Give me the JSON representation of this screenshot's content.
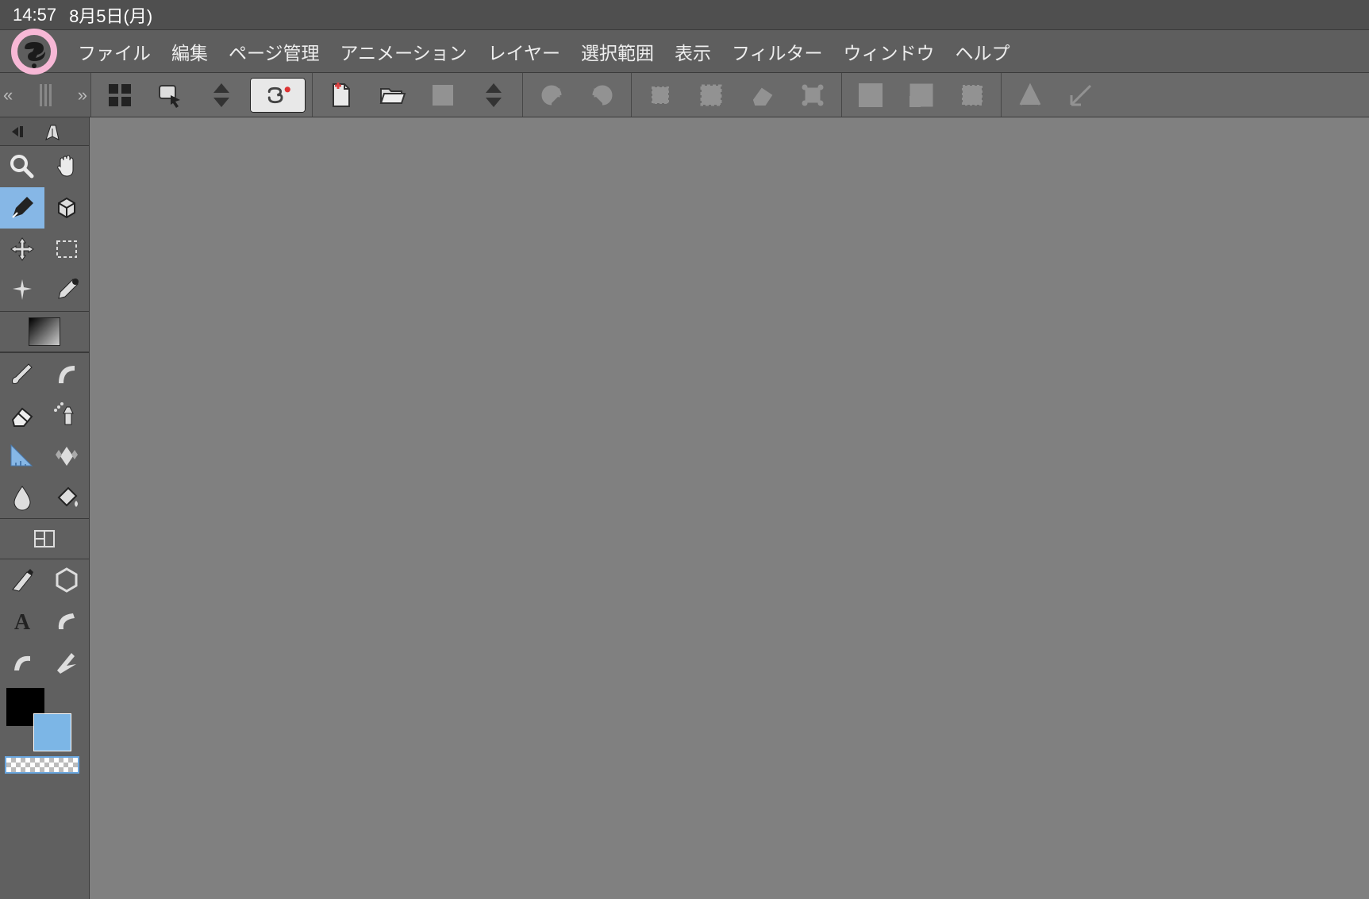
{
  "status": {
    "time": "14:57",
    "date": "8月5日(月)"
  },
  "app_icon": "clip-studio-logo",
  "menu": {
    "items": [
      "ファイル",
      "編集",
      "ページ管理",
      "アニメーション",
      "レイヤー",
      "選択範囲",
      "表示",
      "フィルター",
      "ウィンドウ",
      "ヘルプ"
    ]
  },
  "commandbar": {
    "nav_left": "«",
    "nav_right": "»",
    "groups": [
      {
        "name": "quick-access",
        "buttons": [
          {
            "id": "quick-access-btn",
            "icon": "four-squares",
            "interactable": true
          },
          {
            "id": "assets-btn",
            "icon": "asset-cursor",
            "interactable": true
          },
          {
            "id": "stepper-1",
            "icon": "stepper",
            "interactable": true
          },
          {
            "id": "clip-btn",
            "icon": "clip-logo-rec",
            "interactable": true,
            "active": true
          }
        ]
      },
      {
        "name": "file",
        "buttons": [
          {
            "id": "new-file-btn",
            "icon": "new-file",
            "interactable": true
          },
          {
            "id": "open-file-btn",
            "icon": "open-folder",
            "interactable": true
          },
          {
            "id": "save-btn",
            "icon": "save",
            "interactable": true,
            "disabled": true
          },
          {
            "id": "stepper-2",
            "icon": "stepper",
            "interactable": true
          }
        ]
      },
      {
        "name": "undo",
        "buttons": [
          {
            "id": "undo-btn",
            "icon": "undo",
            "interactable": true,
            "disabled": true
          },
          {
            "id": "redo-btn",
            "icon": "redo",
            "interactable": true,
            "disabled": true
          }
        ]
      },
      {
        "name": "selection",
        "buttons": [
          {
            "id": "deselect-btn",
            "icon": "deselect",
            "interactable": true,
            "disabled": true
          },
          {
            "id": "select-all-btn",
            "icon": "select-all",
            "interactable": true,
            "disabled": true
          },
          {
            "id": "clear-btn",
            "icon": "clear",
            "interactable": true,
            "disabled": true
          },
          {
            "id": "fit-btn",
            "icon": "fit",
            "interactable": true,
            "disabled": true
          }
        ]
      },
      {
        "name": "transform",
        "buttons": [
          {
            "id": "scale-down-btn",
            "icon": "scale-down",
            "interactable": true,
            "disabled": true
          },
          {
            "id": "scale-up-btn",
            "icon": "scale-up",
            "interactable": true,
            "disabled": true
          },
          {
            "id": "crop-btn",
            "icon": "crop",
            "interactable": true,
            "disabled": true
          }
        ]
      },
      {
        "name": "snap",
        "buttons": [
          {
            "id": "snap-off-btn",
            "icon": "snap-off",
            "interactable": true,
            "disabled": true
          },
          {
            "id": "snap-on-btn",
            "icon": "snap-on",
            "interactable": true,
            "disabled": true
          }
        ]
      }
    ]
  },
  "toolbox": {
    "subtool_open": true,
    "tools": [
      {
        "id": "zoom-tool",
        "icon": "magnifier",
        "selected": false
      },
      {
        "id": "hand-tool",
        "icon": "hand",
        "selected": false
      },
      {
        "id": "pen-tool",
        "icon": "pen",
        "selected": true
      },
      {
        "id": "3d-tool",
        "icon": "cube",
        "selected": false
      },
      {
        "id": "move-tool",
        "icon": "move-arrows",
        "selected": false
      },
      {
        "id": "marquee-tool",
        "icon": "marquee",
        "selected": false
      },
      {
        "id": "wand-tool",
        "icon": "spark",
        "selected": false
      },
      {
        "id": "eyedropper-tool",
        "icon": "eyedropper",
        "selected": false
      }
    ],
    "paint_tools": [
      {
        "id": "brush-tool",
        "icon": "brush"
      },
      {
        "id": "curve-brush-tool",
        "icon": "curve"
      },
      {
        "id": "eraser-tool",
        "icon": "eraser"
      },
      {
        "id": "airbrush-tool",
        "icon": "airbrush"
      },
      {
        "id": "ruler-tool",
        "icon": "ruler"
      },
      {
        "id": "decoration-tool",
        "icon": "diamond-pattern"
      },
      {
        "id": "blend-tool",
        "icon": "droplet"
      },
      {
        "id": "fill-tool",
        "icon": "bucket"
      }
    ],
    "frame_tool": {
      "id": "frame-tool",
      "icon": "frame"
    },
    "shape_tools": [
      {
        "id": "linework-tool",
        "icon": "linework"
      },
      {
        "id": "shape-tool",
        "icon": "hexagon"
      },
      {
        "id": "text-tool",
        "icon": "text-a"
      },
      {
        "id": "balloon-tool",
        "icon": "balloon-tail"
      },
      {
        "id": "correction-tool",
        "icon": "curve2"
      },
      {
        "id": "stream-tool",
        "icon": "flash-arrow"
      }
    ],
    "colors": {
      "foreground": "#000000",
      "background": "#7cb6e6",
      "transparent_selected": true
    }
  }
}
